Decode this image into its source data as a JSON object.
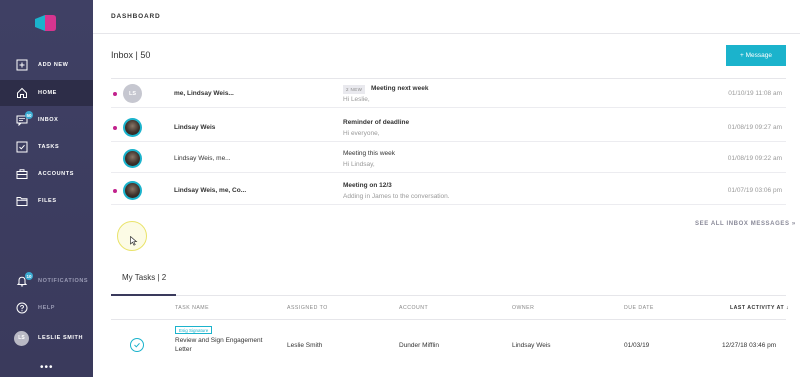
{
  "sidebar": {
    "items": [
      {
        "label": "ADD NEW",
        "icon": "plus-box-icon"
      },
      {
        "label": "HOME",
        "icon": "home-icon"
      },
      {
        "label": "INBOX",
        "icon": "inbox-icon",
        "badge": "50"
      },
      {
        "label": "TASKS",
        "icon": "checkbox-icon"
      },
      {
        "label": "ACCOUNTS",
        "icon": "briefcase-icon"
      },
      {
        "label": "FILES",
        "icon": "folder-icon"
      }
    ],
    "notifications": {
      "label": "NOTIFICATIONS",
      "badge": "10"
    },
    "help": {
      "label": "HELP"
    },
    "user": {
      "initials": "LS",
      "name": "LESLIE SMITH"
    },
    "more": "•••",
    "accent": "#1bb3cc"
  },
  "topbar": {
    "title": "DASHBOARD"
  },
  "inbox": {
    "header": "Inbox | 50",
    "message_button": "+   Message",
    "rows": [
      {
        "from": "me, Lindsay Weis...",
        "tag": "2 NEW",
        "subject": "Meeting next week",
        "preview": "Hi Leslie,",
        "date": "01/10/19 11:08 am",
        "avatar": "LS"
      },
      {
        "from": "Lindsay Weis",
        "subject": "Reminder of deadline",
        "preview": "Hi everyone,",
        "date": "01/08/19 09:27 am"
      },
      {
        "from": "Lindsay Weis, me...",
        "subject": "Meeting this week",
        "preview": "Hi Lindsay,",
        "date": "01/08/19 09:22 am"
      },
      {
        "from": "Lindsay Weis, me, Co...",
        "subject": "Meeting on 12/3",
        "preview": "Adding in James to the conversation.",
        "date": "01/07/19 03:06 pm"
      }
    ],
    "see_all": "SEE ALL INBOX MESSAGES »"
  },
  "tasks": {
    "tab": "My Tasks | 2",
    "columns": [
      "TASK NAME",
      "ASSIGNED TO",
      "ACCOUNT",
      "OWNER",
      "DUE DATE",
      "LAST ACTIVITY AT ↓"
    ],
    "rows": [
      {
        "tag": "Esig Signature",
        "name_line1": "Review and Sign Engagement",
        "name_line2": "Letter",
        "assigned": "Leslie Smith",
        "account": "Dunder Mifflin",
        "owner": "Lindsay Weis",
        "due": "01/03/19",
        "last_activity": "12/27/18 03:46 pm"
      }
    ]
  }
}
